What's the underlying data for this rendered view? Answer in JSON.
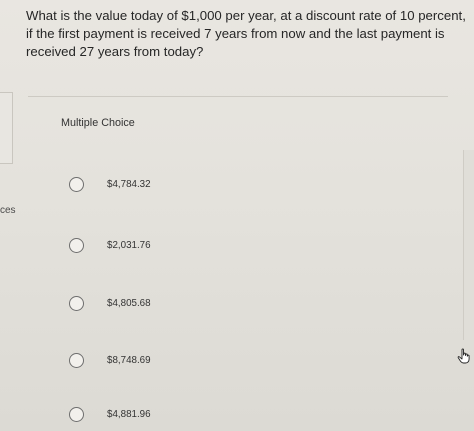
{
  "question": {
    "text": "What is the value today of $1,000 per year, at a discount rate of 10 percent, if the first payment is received 7 years from now and the last payment is received 27 years from today?"
  },
  "multiple_choice_label": "Multiple Choice",
  "options": [
    {
      "label": "$4,784.32"
    },
    {
      "label": "$2,031.76"
    },
    {
      "label": "$4,805.68"
    },
    {
      "label": "$8,748.69"
    },
    {
      "label": "$4,881.96"
    }
  ],
  "left_panel_fragment": "ces",
  "icons": {
    "radio": "radio-circle",
    "cursor": "hand-pointer-icon"
  }
}
